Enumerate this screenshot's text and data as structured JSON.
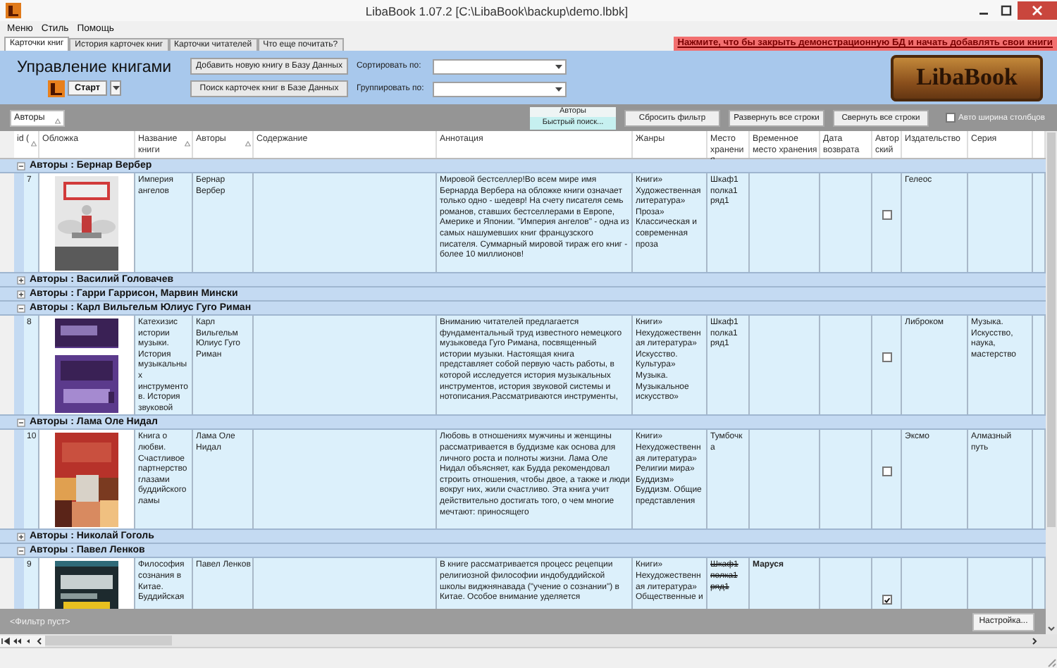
{
  "window": {
    "title": "LibaBook 1.07.2 [C:\\LibaBook\\backup\\demo.lbbk]"
  },
  "menu": [
    "Меню",
    "Стиль",
    "Помощь"
  ],
  "tabs": [
    {
      "label": "Карточки книг",
      "selected": true
    },
    {
      "label": "История карточек книг",
      "selected": false
    },
    {
      "label": "Карточки читателей",
      "selected": false
    },
    {
      "label": "Что еще почитать?",
      "selected": false
    }
  ],
  "demo_banner": "Нажмите, что бы закрыть демонстрационную БД и начать добавлять свои книги",
  "toolbar": {
    "heading": "Управление книгами",
    "start_button": "Старт",
    "buttons": [
      "Добавить новую книгу в Базу Данных",
      "Поиск карточек книг в Базе Данных"
    ],
    "sort_label": "Сортировать по:",
    "group_label": "Группировать по:",
    "logo": "LibaBook"
  },
  "group_panel": {
    "group_chip": "Авторы",
    "quick_search": {
      "title": "Авторы",
      "placeholder": "Быстрый поиск..."
    },
    "buttons": [
      "Сбросить фильтр",
      "Развернуть все строки",
      "Свернуть все строки"
    ],
    "auto_width": {
      "label": "Авто ширина столбцов",
      "checked": false
    }
  },
  "columns": [
    {
      "label": "id (",
      "sort_icon": true
    },
    {
      "label": "Обложка",
      "sort_icon": false
    },
    {
      "label": "Название книги",
      "sort_icon": true
    },
    {
      "label": "Авторы",
      "sort_icon": true
    },
    {
      "label": "Содержание",
      "sort_icon": false
    },
    {
      "label": "Аннотация",
      "sort_icon": false
    },
    {
      "label": "Жанры",
      "sort_icon": false
    },
    {
      "label": "Место хранения",
      "sort_icon": false
    },
    {
      "label": "Временное место хранения",
      "sort_icon": false
    },
    {
      "label": "Дата возврата",
      "sort_icon": false
    },
    {
      "label": "Авторский",
      "sort_icon": false
    },
    {
      "label": "Издательство",
      "sort_icon": false
    },
    {
      "label": "Серия",
      "sort_icon": false
    }
  ],
  "groups": [
    {
      "label": "Авторы : Бернар Вербер",
      "expanded": true,
      "rows": [
        {
          "id": "7",
          "title": "Империя ангелов",
          "authors": "Бернар Вербер",
          "annotation": "Мировой бестселлер!Во всем мире имя Бернарда Вербера на обложке книги означает только одно - шедевр! На счету писателя семь романов, ставших бестселлерами в Европе, Америке и Японии. \"Империя ангелов\" - одна из самых нашумевших книг французского писателя. Суммарный мировой тираж его книг - более 10 миллионов!",
          "genres": "Книги» Художественная литература» Проза» Классическая и современная проза",
          "place": "Шкаф1 полка1 ряд1",
          "place_struck": false,
          "author_copy": false,
          "publisher": "Гелеос"
        }
      ]
    },
    {
      "label": "Авторы : Василий Головачев",
      "expanded": false
    },
    {
      "label": "Авторы : Гарри Гаррисон, Марвин Мински",
      "expanded": false
    },
    {
      "label": "Авторы : Карл Вильгельм Юлиус Гуго Риман",
      "expanded": true,
      "rows": [
        {
          "id": "8",
          "title": "Катехизис истории музыки. История музыкальных инструментов. История звуковой",
          "authors": "Карл Вильгельм Юлиус Гуго Риман",
          "annotation": "Вниманию читателей предлагается фундаментальный труд известного немецкого музыковеда Гуго Римана, посвященный истории музыки. Настоящая книга представляет собой первую часть работы, в которой исследуется история музыкальных инструментов, история звуковой системы и нотописания.Рассматриваются инструменты,",
          "genres": "Книги» Нехудожественная литература» Искусство. Культура» Музыка. Музыкальное искусство»",
          "place": "Шкаф1 полка1 ряд1",
          "place_struck": false,
          "author_copy": false,
          "publisher": "Либроком",
          "series": "Музыка. Искусство, наука, мастерство"
        }
      ]
    },
    {
      "label": "Авторы : Лама Оле Нидал",
      "expanded": true,
      "rows": [
        {
          "id": "10",
          "title": "Книга о любви. Счастливое партнерство глазами буддийского ламы",
          "authors": "Лама Оле Нидал",
          "annotation": "Любовь в отношениях мужчины и женщины рассматривается в буддизме как основа для личного роста и полноты жизни. Лама Оле Нидал объясняет, как Будда рекомендовал строить отношения, чтобы двое, а также и люди вокруг них, жили счастливо. Эта книга учит действительно достигать того, о чем многие мечтают: приносящего",
          "genres": "Книги» Нехудожественная литература» Религии мира» Буддизм» Буддизм. Общие представления",
          "place": "Тумбочка",
          "place_struck": false,
          "author_copy": false,
          "publisher": "Эксмо",
          "series": "Алмазный путь"
        }
      ]
    },
    {
      "label": "Авторы : Николай Гоголь",
      "expanded": false
    },
    {
      "label": "Авторы : Павел Ленков",
      "expanded": true,
      "rows": [
        {
          "id": "9",
          "title": "Философия сознания в Китае. Буддийская",
          "authors": "Павел Ленков",
          "annotation": "В книге рассматривается процесс рецепции религиозной философии индобуддийской школы виджнянавада (\"учение о сознании\") в Китае. Особое внимание уделяется",
          "genres": "Книги» Нехудожественная литература» Общественные и",
          "place": "Шкаф1 полка1 ряд1",
          "place_struck": true,
          "temp_place": "Маруся",
          "author_copy": true
        }
      ]
    }
  ],
  "footer": {
    "filter": "<Фильтр пуст>",
    "settings_button": "Настройка..."
  }
}
